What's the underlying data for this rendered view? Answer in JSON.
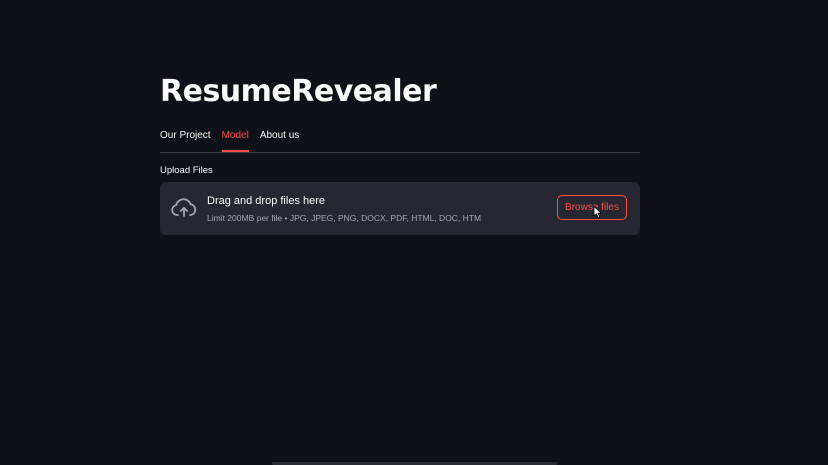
{
  "app": {
    "title": "ResumeRevealer"
  },
  "tabs": [
    {
      "label": "Our Project",
      "active": false
    },
    {
      "label": "Model",
      "active": true
    },
    {
      "label": "About us",
      "active": false
    }
  ],
  "uploader": {
    "label": "Upload Files",
    "drop_text": "Drag and drop files here",
    "limit_text": "Limit 200MB per file • JPG, JPEG, PNG, DOCX, PDF, HTML, DOC, HTM",
    "button_label": "Browse files",
    "icon": "cloud-upload-icon"
  },
  "colors": {
    "background": "#0e1117",
    "accent": "#ff4b4b",
    "dropzone": "#262730",
    "text": "#fafafa",
    "muted": "#a3a8b4"
  }
}
